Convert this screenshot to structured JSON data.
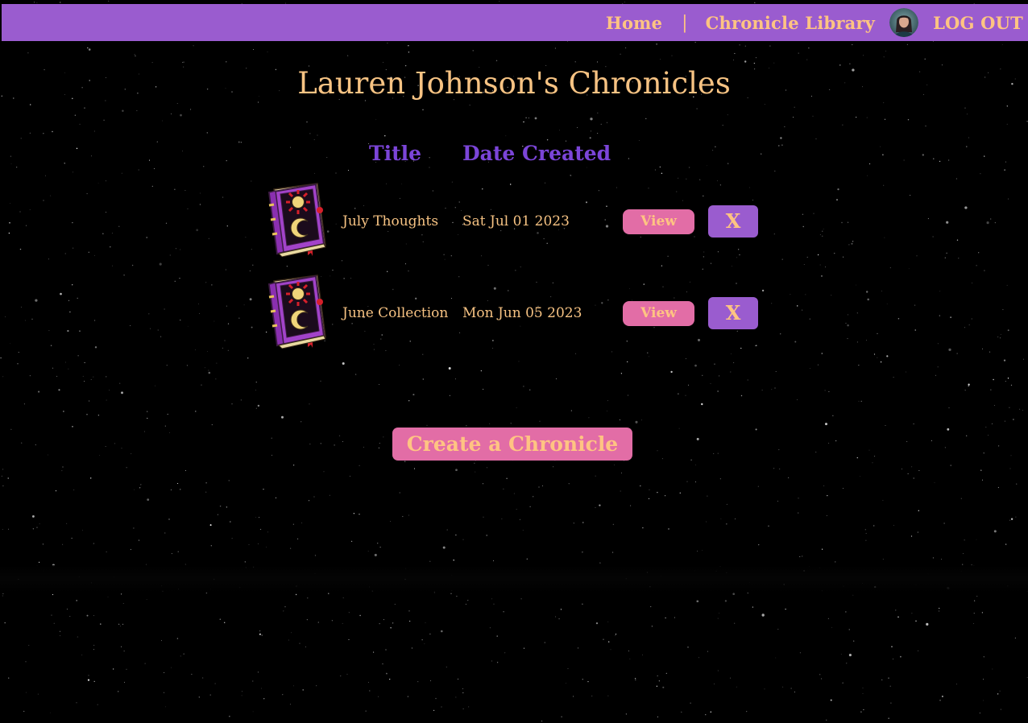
{
  "nav": {
    "home_label": "Home",
    "separator": "|",
    "library_label": "Chronicle Library",
    "logout_label": "LOG OUT"
  },
  "page": {
    "title": "Lauren Johnson's Chronicles"
  },
  "table": {
    "headers": {
      "title": "Title",
      "date": "Date Created"
    },
    "rows": [
      {
        "title": "July Thoughts",
        "date": "Sat Jul 01 2023",
        "view_label": "View",
        "delete_label": "X"
      },
      {
        "title": "June Collection",
        "date": "Mon Jun 05 2023",
        "view_label": "View",
        "delete_label": "X"
      }
    ]
  },
  "actions": {
    "create_label": "Create a Chronicle"
  },
  "colors": {
    "nav_bg": "#9a5ccf",
    "accent_text": "#ffc482",
    "header_text": "#7b45d8",
    "pink_button": "#e26da6",
    "background": "#000000"
  },
  "icons": {
    "row_icon": "chronicle-book-icon",
    "avatar": "user-avatar"
  }
}
